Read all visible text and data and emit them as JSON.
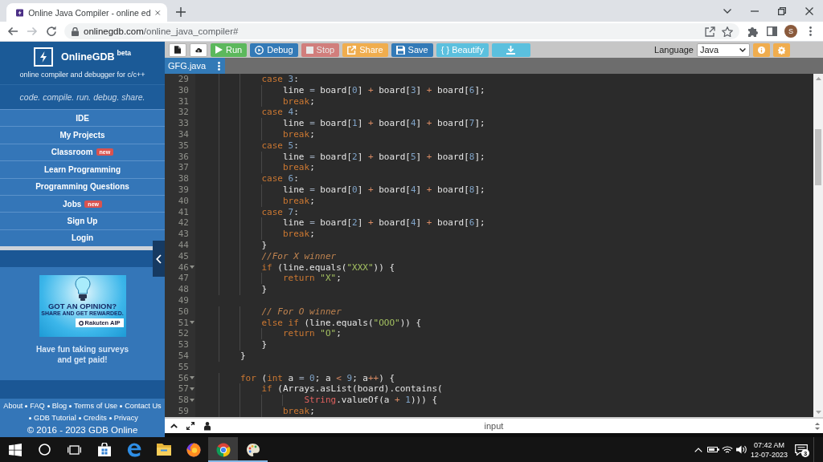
{
  "browser": {
    "tabs": [
      {
        "title": "Online Java Compiler - online ed",
        "selected": true
      }
    ],
    "nav": [
      {
        "kind": "back",
        "disabled": false
      },
      {
        "kind": "forward",
        "disabled": true
      },
      {
        "kind": "reload",
        "disabled": false
      }
    ],
    "address": {
      "host": "onlinegdb.com",
      "path": "/online_java_compiler#"
    },
    "profile": {
      "initial": "S"
    }
  },
  "sidebar": {
    "brand": "OnlineGDB",
    "brand_tag": "beta",
    "subtitle": "online compiler and debugger for c/c++",
    "tagline": "code. compile. run. debug. share.",
    "menu": [
      {
        "label": "IDE"
      },
      {
        "label": "My Projects"
      },
      {
        "label": "Classroom",
        "badge": "new"
      },
      {
        "label": "Learn Programming"
      },
      {
        "label": "Programming Questions"
      },
      {
        "label": "Jobs",
        "badge": "new"
      },
      {
        "label": "Sign Up"
      },
      {
        "label": "Login"
      }
    ],
    "ad": {
      "headline": "GOT AN OPINION?",
      "subline": "SHARE AND GET REWARDED.",
      "brand": "Rakuten AIP"
    },
    "promo": "Have fun taking surveys and get paid!",
    "footer_links": [
      "About",
      "FAQ",
      "Blog",
      "Terms of Use",
      "Contact Us",
      "GDB Tutorial",
      "Credits",
      "Privacy"
    ],
    "copyright": "© 2016 - 2023 GDB Online"
  },
  "toolbar": {
    "buttons": [
      {
        "kind": "new-file",
        "disabled": false
      },
      {
        "kind": "upload",
        "disabled": false
      },
      {
        "kind": "run",
        "label": "Run",
        "disabled": false
      },
      {
        "kind": "debug",
        "label": "Debug",
        "disabled": false
      },
      {
        "kind": "stop",
        "label": "Stop",
        "disabled": true
      },
      {
        "kind": "share",
        "label": "Share",
        "disabled": false
      },
      {
        "kind": "save",
        "label": "Save",
        "disabled": false
      },
      {
        "kind": "beautify",
        "label": "{ } Beautify",
        "disabled": false
      },
      {
        "kind": "download",
        "disabled": false
      }
    ],
    "language_label": "Language",
    "language": "Java",
    "actions": [
      {
        "kind": "info"
      },
      {
        "kind": "settings"
      }
    ]
  },
  "editor": {
    "file_tabs": [
      {
        "name": "GFG.java",
        "selected": true
      }
    ],
    "lines": [
      {
        "number": "29",
        "fold": false,
        "tokens": [
          {
            "kind": "keyword",
            "text": "            case"
          },
          {
            "kind": "number",
            "text": " 3"
          },
          {
            "kind": "plain",
            "text": ":"
          }
        ]
      },
      {
        "number": "30",
        "fold": false,
        "tokens": [
          {
            "kind": "plain",
            "text": "                line "
          },
          {
            "kind": "assign",
            "text": "="
          },
          {
            "kind": "plain",
            "text": " board["
          },
          {
            "kind": "number",
            "text": "0"
          },
          {
            "kind": "plain",
            "text": "] "
          },
          {
            "kind": "operator",
            "text": "+"
          },
          {
            "kind": "plain",
            "text": " board["
          },
          {
            "kind": "number",
            "text": "3"
          },
          {
            "kind": "plain",
            "text": "] "
          },
          {
            "kind": "operator",
            "text": "+"
          },
          {
            "kind": "plain",
            "text": " board["
          },
          {
            "kind": "number",
            "text": "6"
          },
          {
            "kind": "plain",
            "text": "];"
          }
        ]
      },
      {
        "number": "31",
        "fold": false,
        "tokens": [
          {
            "kind": "keyword",
            "text": "                break"
          },
          {
            "kind": "plain",
            "text": ";"
          }
        ]
      },
      {
        "number": "32",
        "fold": false,
        "tokens": [
          {
            "kind": "keyword",
            "text": "            case"
          },
          {
            "kind": "number",
            "text": " 4"
          },
          {
            "kind": "plain",
            "text": ":"
          }
        ]
      },
      {
        "number": "33",
        "fold": false,
        "tokens": [
          {
            "kind": "plain",
            "text": "                line "
          },
          {
            "kind": "assign",
            "text": "="
          },
          {
            "kind": "plain",
            "text": " board["
          },
          {
            "kind": "number",
            "text": "1"
          },
          {
            "kind": "plain",
            "text": "] "
          },
          {
            "kind": "operator",
            "text": "+"
          },
          {
            "kind": "plain",
            "text": " board["
          },
          {
            "kind": "number",
            "text": "4"
          },
          {
            "kind": "plain",
            "text": "] "
          },
          {
            "kind": "operator",
            "text": "+"
          },
          {
            "kind": "plain",
            "text": " board["
          },
          {
            "kind": "number",
            "text": "7"
          },
          {
            "kind": "plain",
            "text": "];"
          }
        ]
      },
      {
        "number": "34",
        "fold": false,
        "tokens": [
          {
            "kind": "keyword",
            "text": "                break"
          },
          {
            "kind": "plain",
            "text": ";"
          }
        ]
      },
      {
        "number": "35",
        "fold": false,
        "tokens": [
          {
            "kind": "keyword",
            "text": "            case"
          },
          {
            "kind": "number",
            "text": " 5"
          },
          {
            "kind": "plain",
            "text": ":"
          }
        ]
      },
      {
        "number": "36",
        "fold": false,
        "tokens": [
          {
            "kind": "plain",
            "text": "                line "
          },
          {
            "kind": "assign",
            "text": "="
          },
          {
            "kind": "plain",
            "text": " board["
          },
          {
            "kind": "number",
            "text": "2"
          },
          {
            "kind": "plain",
            "text": "] "
          },
          {
            "kind": "operator",
            "text": "+"
          },
          {
            "kind": "plain",
            "text": " board["
          },
          {
            "kind": "number",
            "text": "5"
          },
          {
            "kind": "plain",
            "text": "] "
          },
          {
            "kind": "operator",
            "text": "+"
          },
          {
            "kind": "plain",
            "text": " board["
          },
          {
            "kind": "number",
            "text": "8"
          },
          {
            "kind": "plain",
            "text": "];"
          }
        ]
      },
      {
        "number": "37",
        "fold": false,
        "tokens": [
          {
            "kind": "keyword",
            "text": "                break"
          },
          {
            "kind": "plain",
            "text": ";"
          }
        ]
      },
      {
        "number": "38",
        "fold": false,
        "tokens": [
          {
            "kind": "keyword",
            "text": "            case"
          },
          {
            "kind": "number",
            "text": " 6"
          },
          {
            "kind": "plain",
            "text": ":"
          }
        ]
      },
      {
        "number": "39",
        "fold": false,
        "tokens": [
          {
            "kind": "plain",
            "text": "                line "
          },
          {
            "kind": "assign",
            "text": "="
          },
          {
            "kind": "plain",
            "text": " board["
          },
          {
            "kind": "number",
            "text": "0"
          },
          {
            "kind": "plain",
            "text": "] "
          },
          {
            "kind": "operator",
            "text": "+"
          },
          {
            "kind": "plain",
            "text": " board["
          },
          {
            "kind": "number",
            "text": "4"
          },
          {
            "kind": "plain",
            "text": "] "
          },
          {
            "kind": "operator",
            "text": "+"
          },
          {
            "kind": "plain",
            "text": " board["
          },
          {
            "kind": "number",
            "text": "8"
          },
          {
            "kind": "plain",
            "text": "];"
          }
        ]
      },
      {
        "number": "40",
        "fold": false,
        "tokens": [
          {
            "kind": "keyword",
            "text": "                break"
          },
          {
            "kind": "plain",
            "text": ";"
          }
        ]
      },
      {
        "number": "41",
        "fold": false,
        "tokens": [
          {
            "kind": "keyword",
            "text": "            case"
          },
          {
            "kind": "number",
            "text": " 7"
          },
          {
            "kind": "plain",
            "text": ":"
          }
        ]
      },
      {
        "number": "42",
        "fold": false,
        "tokens": [
          {
            "kind": "plain",
            "text": "                line "
          },
          {
            "kind": "assign",
            "text": "="
          },
          {
            "kind": "plain",
            "text": " board["
          },
          {
            "kind": "number",
            "text": "2"
          },
          {
            "kind": "plain",
            "text": "] "
          },
          {
            "kind": "operator",
            "text": "+"
          },
          {
            "kind": "plain",
            "text": " board["
          },
          {
            "kind": "number",
            "text": "4"
          },
          {
            "kind": "plain",
            "text": "] "
          },
          {
            "kind": "operator",
            "text": "+"
          },
          {
            "kind": "plain",
            "text": " board["
          },
          {
            "kind": "number",
            "text": "6"
          },
          {
            "kind": "plain",
            "text": "];"
          }
        ]
      },
      {
        "number": "43",
        "fold": false,
        "tokens": [
          {
            "kind": "keyword",
            "text": "                break"
          },
          {
            "kind": "plain",
            "text": ";"
          }
        ]
      },
      {
        "number": "44",
        "fold": false,
        "tokens": [
          {
            "kind": "plain",
            "text": "            }"
          }
        ]
      },
      {
        "number": "45",
        "fold": false,
        "tokens": [
          {
            "kind": "comment",
            "text": "            //For X winner"
          }
        ]
      },
      {
        "number": "46",
        "fold": true,
        "tokens": [
          {
            "kind": "keyword",
            "text": "            if"
          },
          {
            "kind": "plain",
            "text": " (line.equals("
          },
          {
            "kind": "string",
            "text": "\"XXX\""
          },
          {
            "kind": "plain",
            "text": ")) {"
          }
        ]
      },
      {
        "number": "47",
        "fold": false,
        "tokens": [
          {
            "kind": "keyword",
            "text": "                return"
          },
          {
            "kind": "string",
            "text": " \"X\""
          },
          {
            "kind": "plain",
            "text": ";"
          }
        ]
      },
      {
        "number": "48",
        "fold": false,
        "tokens": [
          {
            "kind": "plain",
            "text": "            }"
          }
        ]
      },
      {
        "number": "49",
        "fold": false
      },
      {
        "number": "50",
        "fold": false,
        "tokens": [
          {
            "kind": "comment",
            "text": "            // For O winner"
          }
        ]
      },
      {
        "number": "51",
        "fold": true,
        "tokens": [
          {
            "kind": "keyword",
            "text": "            else if"
          },
          {
            "kind": "plain",
            "text": " (line.equals("
          },
          {
            "kind": "string",
            "text": "\"OOO\""
          },
          {
            "kind": "plain",
            "text": ")) {"
          }
        ]
      },
      {
        "number": "52",
        "fold": false,
        "tokens": [
          {
            "kind": "keyword",
            "text": "                return"
          },
          {
            "kind": "string",
            "text": " \"O\""
          },
          {
            "kind": "plain",
            "text": ";"
          }
        ]
      },
      {
        "number": "53",
        "fold": false,
        "tokens": [
          {
            "kind": "plain",
            "text": "            }"
          }
        ]
      },
      {
        "number": "54",
        "fold": false,
        "tokens": [
          {
            "kind": "plain",
            "text": "        }"
          }
        ]
      },
      {
        "number": "55",
        "fold": false
      },
      {
        "number": "56",
        "fold": true,
        "tokens": [
          {
            "kind": "keyword",
            "text": "        for"
          },
          {
            "kind": "plain",
            "text": " ("
          },
          {
            "kind": "keyword",
            "text": "int"
          },
          {
            "kind": "plain",
            "text": " a "
          },
          {
            "kind": "assign",
            "text": "="
          },
          {
            "kind": "number",
            "text": " 0"
          },
          {
            "kind": "plain",
            "text": "; a "
          },
          {
            "kind": "operator",
            "text": "<"
          },
          {
            "kind": "number",
            "text": " 9"
          },
          {
            "kind": "plain",
            "text": "; a"
          },
          {
            "kind": "operator",
            "text": "++"
          },
          {
            "kind": "plain",
            "text": ") {"
          }
        ]
      },
      {
        "number": "57",
        "fold": true,
        "tokens": [
          {
            "kind": "keyword",
            "text": "            if"
          },
          {
            "kind": "plain",
            "text": " (Arrays.asList(board).contains("
          }
        ]
      },
      {
        "number": "58",
        "fold": true,
        "tokens": [
          {
            "kind": "type",
            "text": "                    String"
          },
          {
            "kind": "plain",
            "text": ".valueOf(a "
          },
          {
            "kind": "operator",
            "text": "+"
          },
          {
            "kind": "number",
            "text": " 1"
          },
          {
            "kind": "plain",
            "text": "))) {"
          }
        ]
      },
      {
        "number": "59",
        "fold": false,
        "tokens": [
          {
            "kind": "keyword",
            "text": "                break"
          },
          {
            "kind": "plain",
            "text": ";"
          }
        ]
      }
    ]
  },
  "io_panel": {
    "label": "input"
  },
  "taskbar": {
    "system": [
      {
        "kind": "start"
      },
      {
        "kind": "search"
      },
      {
        "kind": "task-view"
      }
    ],
    "apps": [
      {
        "kind": "store",
        "running": false,
        "selected": false
      },
      {
        "kind": "edge",
        "running": false,
        "selected": false
      },
      {
        "kind": "explorer",
        "running": false,
        "selected": false
      },
      {
        "kind": "firefox",
        "running": false,
        "selected": false
      },
      {
        "kind": "chrome",
        "running": true,
        "selected": true
      },
      {
        "kind": "paint",
        "running": true,
        "selected": false
      }
    ],
    "tray": [
      {
        "kind": "chevron"
      },
      {
        "kind": "battery"
      },
      {
        "kind": "wifi"
      },
      {
        "kind": "volume"
      }
    ],
    "time": "07:42 AM",
    "date": "12-07-2023",
    "notification_count": "3"
  }
}
